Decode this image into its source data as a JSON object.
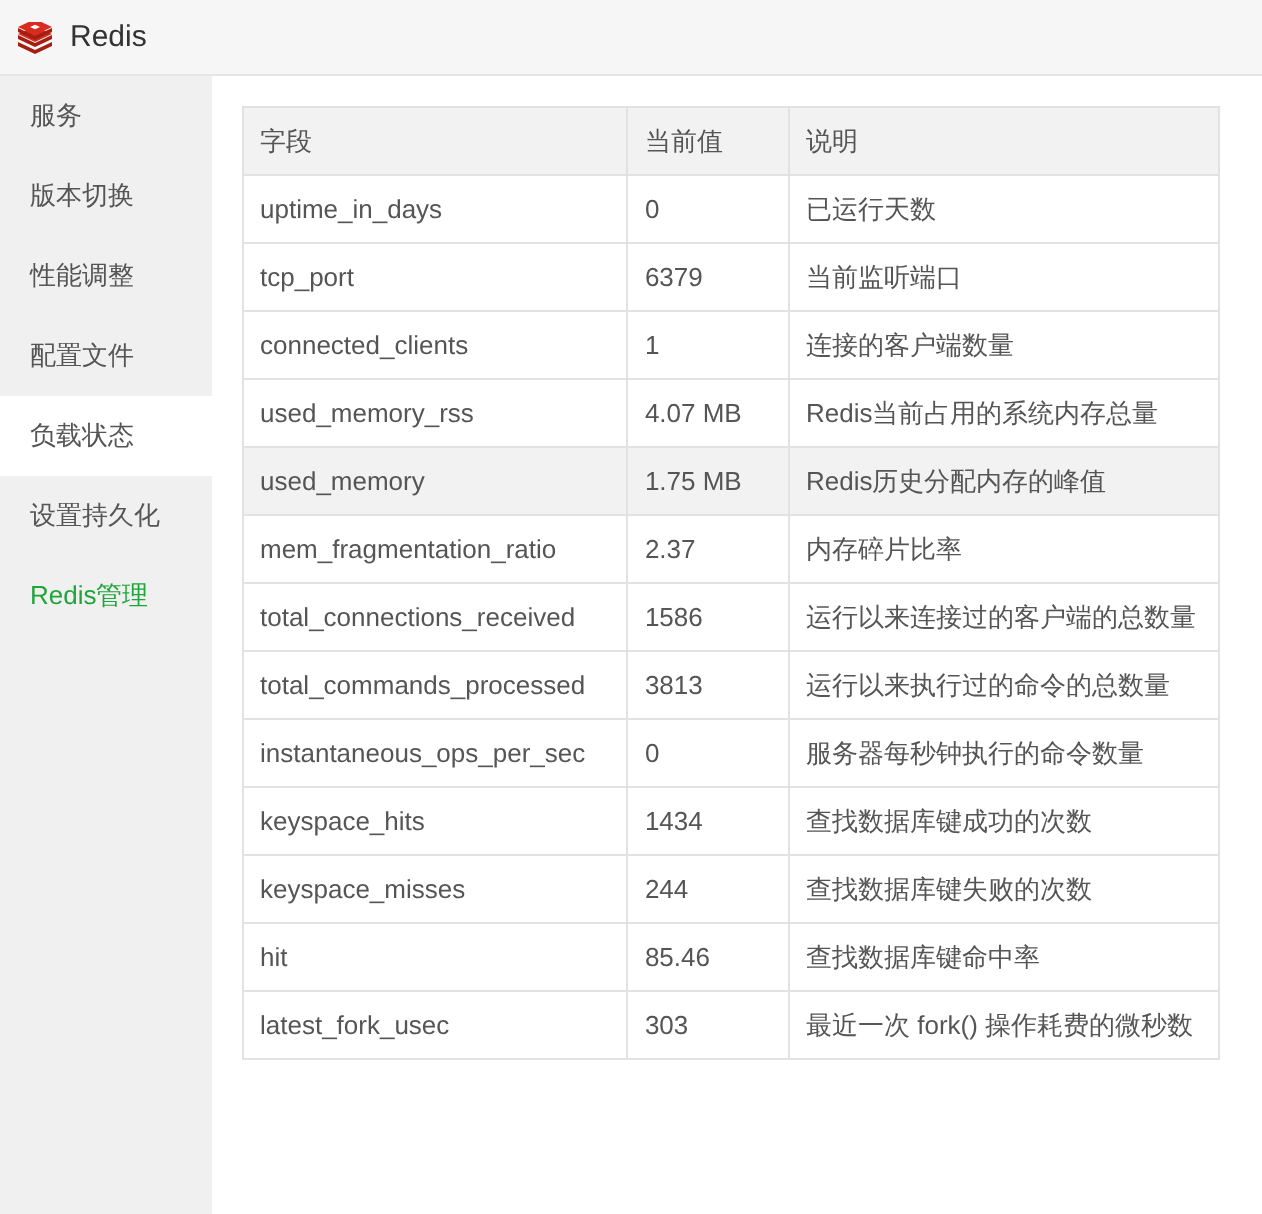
{
  "window": {
    "title": "Redis"
  },
  "sidebar": {
    "items": [
      {
        "label": "服务",
        "selected": false,
        "kind": "menu"
      },
      {
        "label": "版本切换",
        "selected": false,
        "kind": "menu"
      },
      {
        "label": "性能调整",
        "selected": false,
        "kind": "menu"
      },
      {
        "label": "配置文件",
        "selected": false,
        "kind": "menu"
      },
      {
        "label": "负载状态",
        "selected": true,
        "kind": "menu"
      },
      {
        "label": "设置持久化",
        "selected": false,
        "kind": "menu"
      },
      {
        "label": "Redis管理",
        "selected": false,
        "kind": "link"
      }
    ]
  },
  "table": {
    "columns": [
      "字段",
      "当前值",
      "说明"
    ],
    "rows": [
      {
        "cells": [
          "uptime_in_days",
          "0",
          "已运行天数"
        ],
        "highlighted": false
      },
      {
        "cells": [
          "tcp_port",
          "6379",
          "当前监听端口"
        ],
        "highlighted": false
      },
      {
        "cells": [
          "connected_clients",
          "1",
          "连接的客户端数量"
        ],
        "highlighted": false
      },
      {
        "cells": [
          "used_memory_rss",
          "4.07 MB",
          "Redis当前占用的系统内存总量"
        ],
        "highlighted": false
      },
      {
        "cells": [
          "used_memory",
          "1.75 MB",
          "Redis历史分配内存的峰值"
        ],
        "highlighted": true
      },
      {
        "cells": [
          "mem_fragmentation_ratio",
          "2.37",
          "内存碎片比率"
        ],
        "highlighted": false
      },
      {
        "cells": [
          "total_connections_received",
          "1586",
          "运行以来连接过的客户端的总数量"
        ],
        "highlighted": false
      },
      {
        "cells": [
          "total_commands_processed",
          "3813",
          "运行以来执行过的命令的总数量"
        ],
        "highlighted": false
      },
      {
        "cells": [
          "instantaneous_ops_per_sec",
          "0",
          "服务器每秒钟执行的命令数量"
        ],
        "highlighted": false
      },
      {
        "cells": [
          "keyspace_hits",
          "1434",
          "查找数据库键成功的次数"
        ],
        "highlighted": false
      },
      {
        "cells": [
          "keyspace_misses",
          "244",
          "查找数据库键失败的次数"
        ],
        "highlighted": false
      },
      {
        "cells": [
          "hit",
          "85.46",
          "查找数据库键命中率"
        ],
        "highlighted": false
      },
      {
        "cells": [
          "latest_fork_usec",
          "303",
          "最近一次 fork() 操作耗费的微秒数"
        ],
        "highlighted": false
      }
    ]
  }
}
